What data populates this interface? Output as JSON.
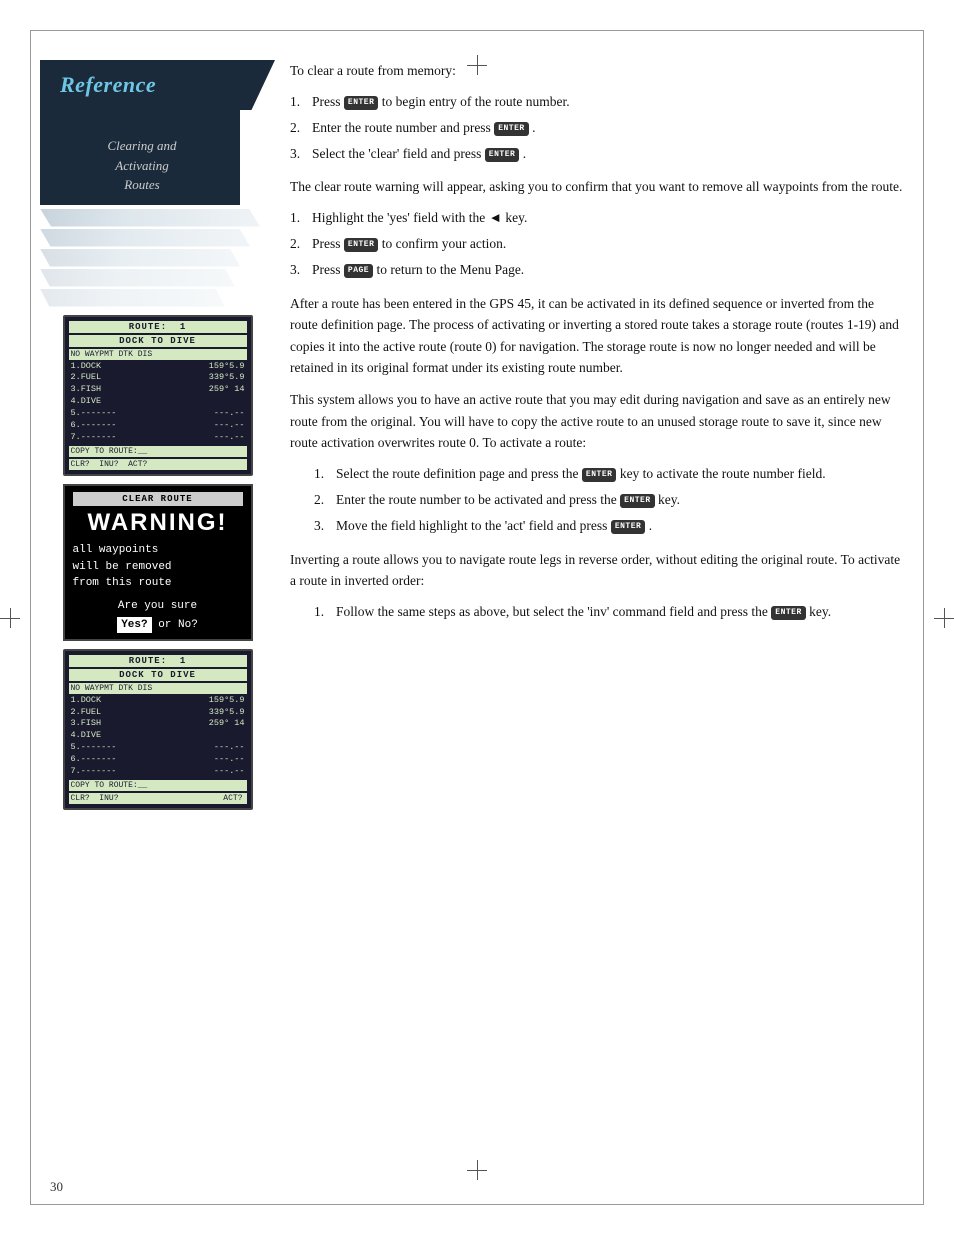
{
  "page": {
    "number": "30",
    "title": "Reference"
  },
  "sidebar": {
    "title": "Reference",
    "subtitle_line1": "Clearing and",
    "subtitle_line2": "Activating",
    "subtitle_line3": "Routes"
  },
  "keys": {
    "enter": "ENTER",
    "page": "PAGE"
  },
  "clear_route_section": {
    "intro": "To clear a route from memory:",
    "steps": [
      {
        "num": "1.",
        "text": "Press",
        "key": "ENTER",
        "text2": "to begin entry of the route number."
      },
      {
        "num": "2.",
        "text": "Enter the route number and press",
        "key": "ENTER",
        "text2": "."
      },
      {
        "num": "3.",
        "text": "Select the 'clear' field and press",
        "key": "ENTER",
        "text2": "."
      }
    ],
    "warning_text": "The clear route warning will appear, asking you to confirm that you want to remove all waypoints from the route.",
    "confirm_steps": [
      {
        "num": "1.",
        "text": "Highlight the 'yes' field with the ◄ key."
      },
      {
        "num": "2.",
        "text": "Press",
        "key": "ENTER",
        "text2": "to confirm your action."
      },
      {
        "num": "3.",
        "text": "Press",
        "key": "PAGE",
        "text2": "to return to the Menu Page."
      }
    ]
  },
  "activate_route_section": {
    "intro_text": "After a route has been entered in the GPS 45, it can be activated in its defined sequence or inverted from the route definition page. The process of activating or inverting a stored route takes a storage route (routes 1-19) and copies it into the active route (route 0) for navigation. The storage route is now no longer needed and will be retained in its original format under its existing route number.",
    "system_text": "This system allows you to have an active route that you may edit during navigation and save as an entirely new route from the original. You will have to copy the active route to an unused storage route to save it, since new route activation overwrites route 0. To activate a route:",
    "steps": [
      {
        "num": "1.",
        "text": "Select the route definition page and press the",
        "key": "ENTER",
        "text2": "key to activate the route number field."
      },
      {
        "num": "2.",
        "text": "Enter the route number to be activated and press the",
        "key": "ENTER",
        "text2": "key."
      },
      {
        "num": "3.",
        "text": "Move the field highlight to the 'act' field and press",
        "key": "ENTER",
        "text2": "."
      }
    ],
    "invert_text": "Inverting a route allows you to navigate route legs in reverse order, without editing the original route. To activate a route in inverted order:",
    "invert_steps": [
      {
        "num": "1.",
        "text": "Follow the same steps as above, but select the 'inv' command field and press the",
        "key": "ENTER",
        "text2": "key."
      }
    ]
  },
  "gps_screen1": {
    "title": "ROUTE:  1",
    "subtitle": "DOCK TO DIVE",
    "col_header": "NO WAYPMT DTK DIS",
    "rows": [
      "1.DOCK   159°5.9",
      "2.FUEL   339°5.9",
      "3.FISH   259° 14",
      "4.DIVE",
      "5.-------  ---.--",
      "6.-------  ---.--",
      "7.-------  ---.--"
    ],
    "footer1": "COPY TO ROUTE:__",
    "footer2": "CLR?  INU?  ACT?"
  },
  "warning_screen": {
    "header": "CLEAR ROUTE",
    "title": "WARNING!",
    "line1": "all waypoints",
    "line2": "will be removed",
    "line3": "from this route",
    "question": "Are you sure",
    "yes_label": "Yes?",
    "no_text": " or No?"
  },
  "gps_screen2": {
    "title": "ROUTE:  1",
    "subtitle": "DOCK TO DIVE",
    "col_header": "NO WAYPMT DTK DIS",
    "rows": [
      "1.DOCK   159°5.9",
      "2.FUEL   339°5.9",
      "3.FISH   259° 14",
      "4.DIVE",
      "5.-------  ---.--",
      "6.-------  ---.--",
      "7.-------  ---.--"
    ],
    "footer1": "COPY TO ROUTE:__",
    "footer2_left": "CLR?  INU?  ",
    "footer2_act": "ACT?"
  }
}
